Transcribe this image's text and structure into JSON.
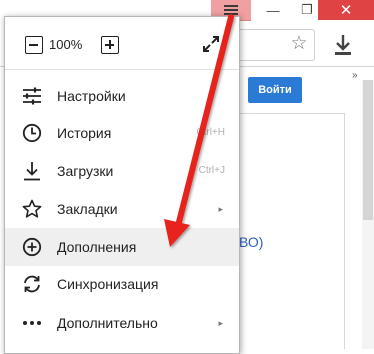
{
  "window": {
    "menu_icon": "hamburger-icon",
    "minimize_glyph": "—",
    "restore_glyph": "❐",
    "close_glyph": "✕",
    "close_color": "#e04343",
    "menu_button_highlight": "#f0a0a0"
  },
  "toolbar": {
    "bookmark_icon": "star-icon",
    "bookmark_glyph": "☆",
    "download_icon": "download-icon",
    "more_glyph": "»"
  },
  "page": {
    "login_button_label": "Войти",
    "login_button_color": "#2b7bd6",
    "link_fragment": "ВО)"
  },
  "menu": {
    "zoom": {
      "value": "100%"
    },
    "items": [
      {
        "label": "Настройки",
        "icon": "sliders-icon",
        "shortcut": "",
        "submenu": false
      },
      {
        "label": "История",
        "icon": "clock-icon",
        "shortcut": "Ctrl+H",
        "submenu": false
      },
      {
        "label": "Загрузки",
        "icon": "download-icon",
        "shortcut": "Ctrl+J",
        "submenu": false
      },
      {
        "label": "Закладки",
        "icon": "star-icon",
        "shortcut": "",
        "submenu": true
      },
      {
        "label": "Дополнения",
        "icon": "plus-circle-icon",
        "shortcut": "",
        "submenu": false,
        "highlighted": true
      },
      {
        "label": "Синхронизация",
        "icon": "sync-icon",
        "shortcut": "",
        "submenu": false
      },
      {
        "label": "Дополнительно",
        "icon": "dots-icon",
        "shortcut": "",
        "submenu": true
      }
    ],
    "submenu_glyph": "▸"
  },
  "annotation": {
    "arrow_color": "#e8231c"
  }
}
